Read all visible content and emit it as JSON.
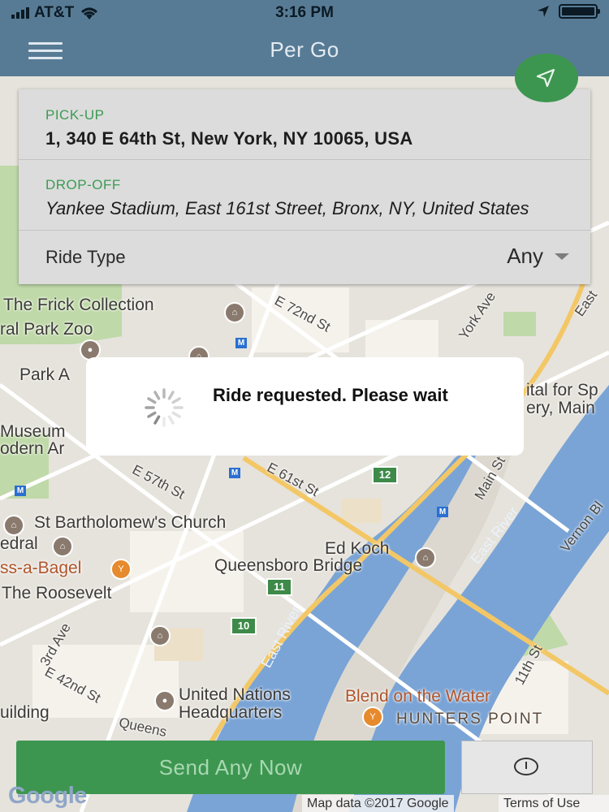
{
  "status_bar": {
    "carrier": "AT&T",
    "time": "3:16 PM"
  },
  "nav": {
    "title": "Per Go"
  },
  "icons": {
    "menu": "menu-icon",
    "wifi": "wifi-icon",
    "location": "location-arrow-icon",
    "battery": "battery-icon",
    "navigate": "navigation-arrow-icon",
    "spinner": "spinner-icon",
    "timer": "clock-icon",
    "dropdown": "caret-down-icon"
  },
  "pickup": {
    "label": "PICK-UP",
    "value": "1, 340 E 64th St, New York, NY 10065, USA"
  },
  "dropoff": {
    "label": "DROP-OFF",
    "value": "Yankee Stadium, East 161st Street, Bronx, NY, United States"
  },
  "ride_type": {
    "label": "Ride Type",
    "value": "Any"
  },
  "dialog": {
    "message": "Ride requested. Please wait"
  },
  "actions": {
    "send_label": "Send Any Now"
  },
  "map": {
    "labels": {
      "frick": "The Frick Collection",
      "zoo": "ral Park Zoo",
      "park": "Park A",
      "museum1": "Museum",
      "museum2": "odern Ar",
      "bartholomew": "St Bartholomew's Church",
      "edral": "edral",
      "bagel": "ss-a-Bagel",
      "roosevelt": "The Roosevelt",
      "edkoch1": "Ed Koch",
      "edkoch2": "Queensboro Bridge",
      "un1": "United Nations",
      "un2": "Headquarters",
      "blend": "Blend on the Water",
      "hunters": "HUNTERS POINT",
      "uilding": "uilding",
      "queens": "Queens",
      "east_river_1": "East River",
      "east_river_2": "East River",
      "e72": "E 72nd St",
      "york": "York Ave",
      "e57": "E 57th St",
      "e61": "E 61st St",
      "e42": "E 42nd St",
      "third": "3rd Ave",
      "main": "Main St",
      "vernon": "Vernon Bl",
      "eleventh": "11th St",
      "east": "East",
      "ital": "ital for Sp",
      "ery": "ery, Main",
      "route_12": "12",
      "route_11": "11",
      "route_10": "10"
    },
    "copyright": "Map data ©2017 Google",
    "terms": "Terms of Use",
    "google": "Google"
  }
}
